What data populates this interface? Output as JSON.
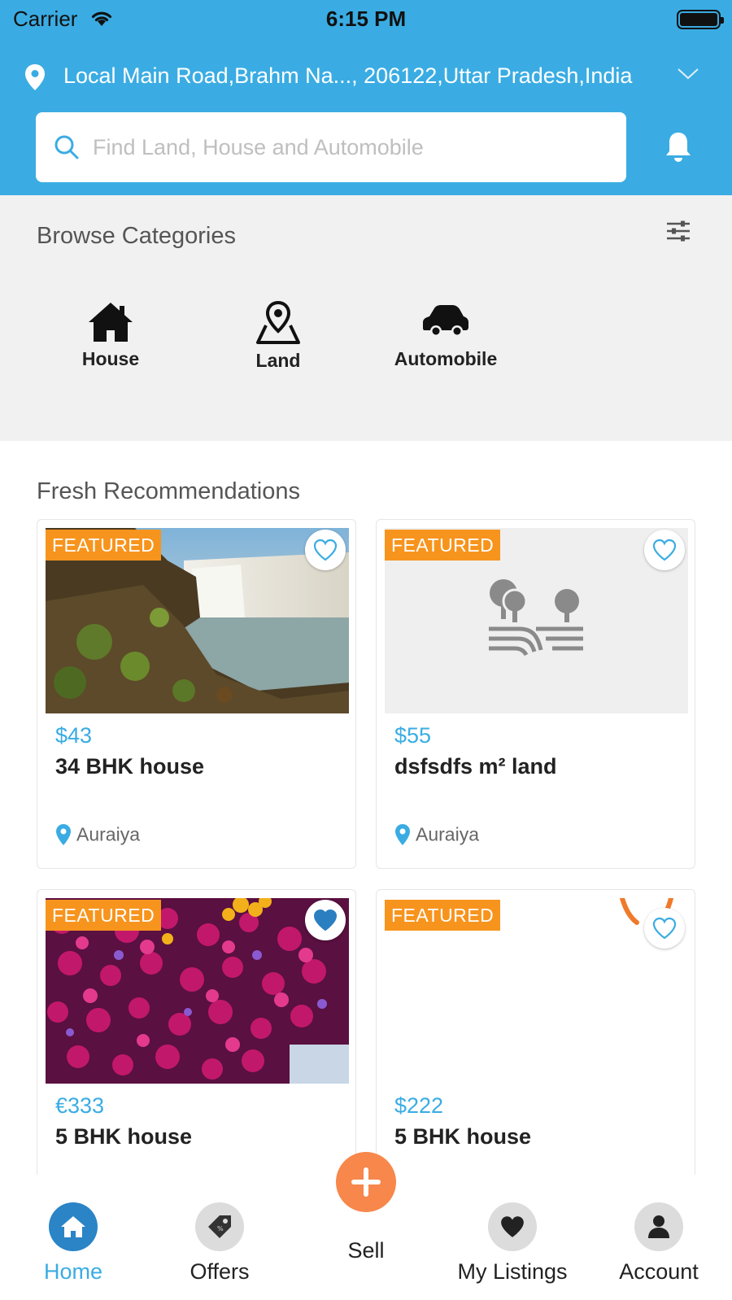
{
  "status_bar": {
    "carrier": "Carrier",
    "time": "6:15 PM"
  },
  "location": {
    "text": "Local Main Road,Brahm Na..., 206122,Uttar Pradesh,India"
  },
  "search": {
    "placeholder": "Find Land, House and Automobile"
  },
  "categories": {
    "title": "Browse Categories",
    "items": [
      {
        "label": "House",
        "icon": "house-icon"
      },
      {
        "label": "Land",
        "icon": "map-pin-icon"
      },
      {
        "label": "Automobile",
        "icon": "car-icon"
      }
    ]
  },
  "recommendations": {
    "title": "Fresh Recommendations",
    "cards": [
      {
        "badge": "FEATURED",
        "price": "$43",
        "title": "34 BHK house",
        "location": "Auraiya",
        "favorited": false,
        "image": "waterfall-photo"
      },
      {
        "badge": "FEATURED",
        "price": "$55",
        "title": "dsfsdfs m² land",
        "location": "Auraiya",
        "favorited": false,
        "image": "land-placeholder-icon"
      },
      {
        "badge": "FEATURED",
        "price": "€333",
        "title": "5 BHK house",
        "location": "",
        "favorited": true,
        "image": "flowers-photo"
      },
      {
        "badge": "FEATURED",
        "price": "$222",
        "title": "5 BHK house",
        "location": "",
        "favorited": false,
        "image": "blank"
      }
    ]
  },
  "nav": {
    "items": [
      {
        "label": "Home",
        "icon": "home-icon",
        "active": true
      },
      {
        "label": "Offers",
        "icon": "tag-icon",
        "active": false
      },
      {
        "label": "Sell",
        "icon": "plus-icon",
        "active": false
      },
      {
        "label": "My Listings",
        "icon": "heart-icon",
        "active": false
      },
      {
        "label": "Account",
        "icon": "user-icon",
        "active": false
      }
    ]
  },
  "colors": {
    "primary": "#3aace3",
    "accent": "#f7941d",
    "sell": "#f7874b",
    "nav_active": "#2a84c6"
  }
}
